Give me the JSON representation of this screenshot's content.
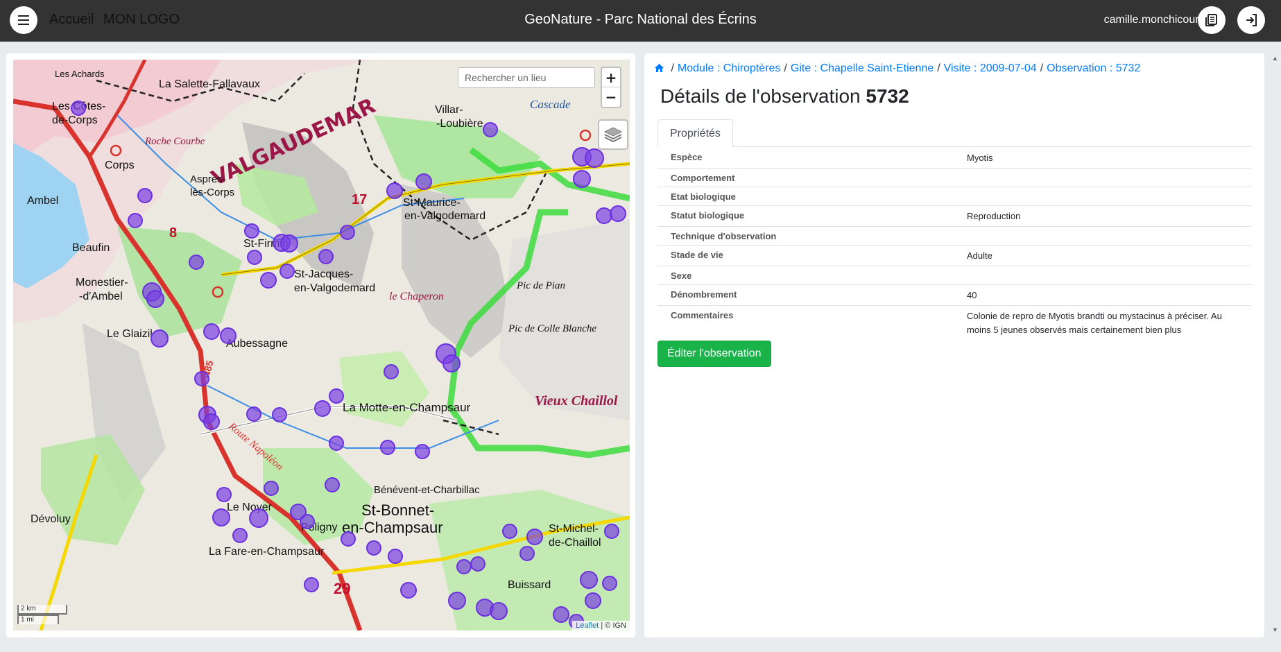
{
  "navbar": {
    "brand_home": "Accueil",
    "brand_logo": "MON LOGO",
    "title": "GeoNature - Parc National des Écrins",
    "user": "camille.monchicourt"
  },
  "map": {
    "search_placeholder": "Rechercher un lieu",
    "zoom_in": "+",
    "zoom_out": "−",
    "scale_km": "2 km",
    "scale_mi": "1 mi",
    "attribution_leaflet": "Leaflet",
    "attribution_rest": " | © IGN",
    "basemap_labels": {
      "valgaudemar": "VALGAUDEMAR",
      "la_salette": "La Salette-Fallavaux",
      "les_achards": "Les Achards",
      "cotes_corps_1": "Les Côtes-",
      "cotes_corps_2": "de-Corps",
      "corps": "Corps",
      "roche_courbe": "Roche Courbe",
      "aspres_1": "Aspres-",
      "aspres_2": "lès-Corps",
      "ambel": "Ambel",
      "beaufin": "Beaufin",
      "monestier_1": "Monestier-",
      "monestier_2": "-d'Ambel",
      "le_glaizil": "Le Glaizil",
      "st_maurice_1": "St-Maurice-",
      "st_maurice_2": "en-Valgodemard",
      "st_firmin": "St-Firmin",
      "st_jacques_1": "St-Jacques-",
      "st_jacques_2": "en-Valgodemard",
      "le_chaperon": "le Chaperon",
      "aubessagne": "Aubessagne",
      "pic_de_pian": "Pic de Pian",
      "pic_colle_blanche": "Pic de Colle Blanche",
      "vieux_chaillol": "Vieux Chaillol",
      "motte": "La Motte-en-Champsaur",
      "st_bonnet_1": "St-Bonnet-",
      "st_bonnet_2": "en-Champsaur",
      "devoluy": "Dévoluy",
      "le_noyer": "Le Noyer",
      "poligny": "Poligny",
      "la_fare": "La Fare-en-Champsaur",
      "st_michel_1": "St-Michel-",
      "st_michel_2": "de-Chaillol",
      "buissard": "Buissard",
      "benevent": "Bénévent-et-Charbillac",
      "villar_1": "Villar-",
      "villar_2": "-Loubière",
      "cascade": "Cascade",
      "route_napoleon": "Route Napoléon",
      "n85": "N85",
      "road_29": "29",
      "road_17": "17",
      "road_8": "8"
    }
  },
  "breadcrumb": {
    "module": "Module : Chiroptères",
    "gite": "Gite : Chapelle Saint-Etienne",
    "visite": "Visite : 2009-07-04",
    "observation": "Observation : 5732"
  },
  "details": {
    "title_prefix": "Détails de l'observation",
    "obs_id": "5732",
    "tab_label": "Propriétés",
    "rows": [
      {
        "label": "Espèce",
        "value": "Myotis"
      },
      {
        "label": "Comportement",
        "value": ""
      },
      {
        "label": "Etat biologique",
        "value": ""
      },
      {
        "label": "Statut biologique",
        "value": "Reproduction"
      },
      {
        "label": "Technique d'observation",
        "value": ""
      },
      {
        "label": "Stade de vie",
        "value": "Adulte"
      },
      {
        "label": "Sexe",
        "value": ""
      },
      {
        "label": "Dénombrement",
        "value": "40"
      },
      {
        "label": "Commentaires",
        "value": "Colonie de repro de Myotis brandti ou mystacinus à préciser. Au moins 5 jeunes observés mais certainement bien plus"
      }
    ],
    "edit_button": "Éditer l'observation"
  },
  "colors": {
    "navbar": "#333333",
    "link": "#007bff",
    "edit_button": "#1ab34a",
    "marker": "#7b3fe4"
  }
}
